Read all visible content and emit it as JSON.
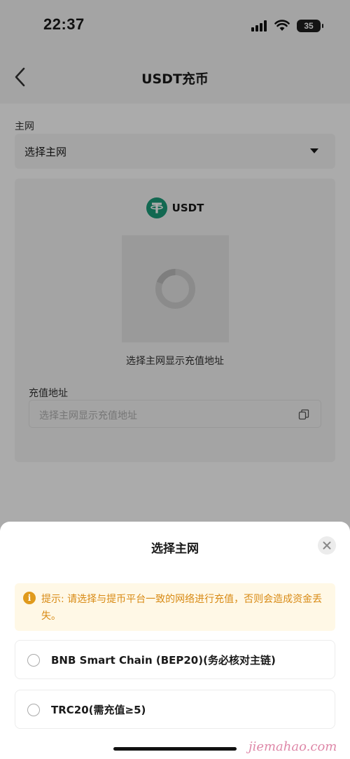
{
  "status_bar": {
    "time": "22:37",
    "battery": "35"
  },
  "nav": {
    "title": "USDT充币"
  },
  "network": {
    "label": "主网",
    "select_value": "选择主网"
  },
  "deposit_card": {
    "coin": "USDT",
    "qr_hint": "选择主网显示充值地址",
    "address_label": "充值地址",
    "address_placeholder": "选择主网显示充值地址"
  },
  "sheet": {
    "title": "选择主网",
    "notice": "提示: 请选择与提币平台一致的网络进行充值，否则会造成资金丢失。",
    "options": [
      {
        "label": "BNB Smart Chain (BEP20)(务必核对主链)"
      },
      {
        "label": "TRC20(需充值≥5)"
      }
    ]
  },
  "watermark": "jiemahao.com",
  "colors": {
    "tether": "#1b9b7a",
    "notice_text": "#d88a14",
    "notice_bg": "#fff8e6"
  },
  "icons": [
    "back-arrow-icon",
    "caret-down-icon",
    "tether-icon",
    "spinner-icon",
    "copy-icon",
    "close-icon",
    "info-icon",
    "radio-icon"
  ]
}
